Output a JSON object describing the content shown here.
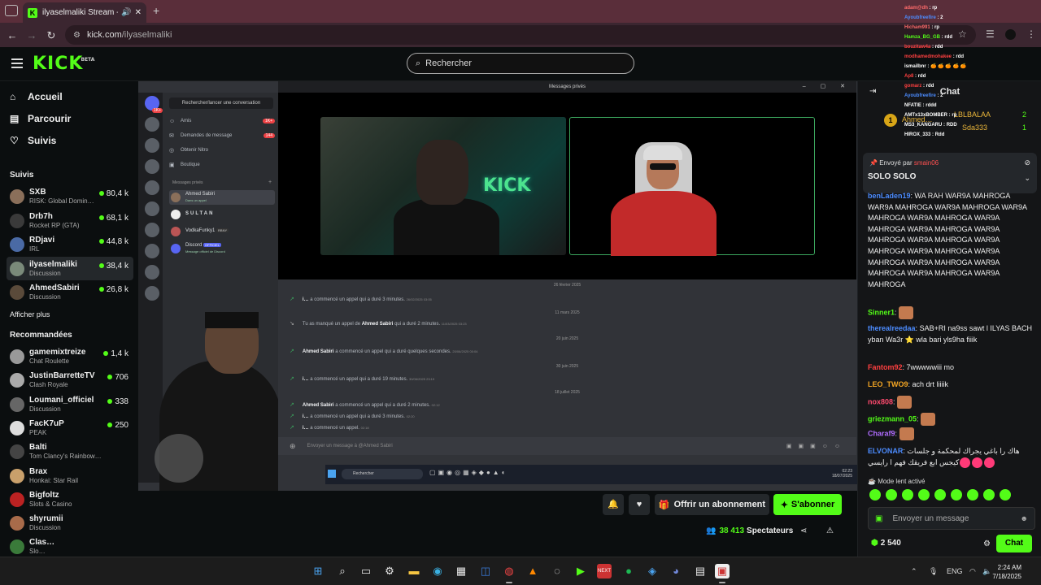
{
  "browser": {
    "tab_title": "ilyaselmaliki Stream - Watc",
    "url_host": "kick.com",
    "url_path": "/ilyaselmaliki"
  },
  "header": {
    "logo": "KICK",
    "logo_badge": "BETA",
    "search_placeholder": "Rechercher"
  },
  "sidebar": {
    "nav": [
      "Accueil",
      "Parcourir",
      "Suivis"
    ],
    "following_title": "Suivis",
    "following": [
      {
        "name": "SXB",
        "category": "RISK: Global Domin…",
        "viewers": "80,4 k"
      },
      {
        "name": "Drb7h",
        "category": "Rocket RP (GTA)",
        "viewers": "68,1 k"
      },
      {
        "name": "RDjavi",
        "category": "IRL",
        "viewers": "44,8 k"
      },
      {
        "name": "ilyaselmaliki",
        "category": "Discussion",
        "viewers": "38,4 k"
      },
      {
        "name": "AhmedSabiri",
        "category": "Discussion",
        "viewers": "26,8 k"
      }
    ],
    "show_more": "Afficher plus",
    "recommended_title": "Recommandées",
    "recommended": [
      {
        "name": "gamemixtreize",
        "category": "Chat Roulette",
        "viewers": "1,4 k"
      },
      {
        "name": "JustinBarretteTV",
        "category": "Clash Royale",
        "viewers": "706"
      },
      {
        "name": "Loumani_officiel",
        "category": "Discussion",
        "viewers": "338"
      },
      {
        "name": "FacK7uP",
        "category": "PEAK",
        "viewers": "250"
      },
      {
        "name": "Balti",
        "category": "Tom Clancy's Rainbow…",
        "viewers": ""
      },
      {
        "name": "Brax",
        "category": "Honkai: Star Rail",
        "viewers": ""
      },
      {
        "name": "Bigfoltz",
        "category": "Slots & Casino",
        "viewers": ""
      },
      {
        "name": "shyrumii",
        "category": "Discussion",
        "viewers": ""
      },
      {
        "name": "Clas…",
        "category": "Slo…",
        "viewers": ""
      }
    ]
  },
  "discord": {
    "window_title": "Messages privés",
    "dm_search": "Rechercher/lancer une conversation",
    "menu": [
      {
        "label": "Amis",
        "badge": "1K+"
      },
      {
        "label": "Demandes de message",
        "badge": "144"
      },
      {
        "label": "Obtenir Nitro",
        "badge": ""
      },
      {
        "label": "Boutique",
        "badge": ""
      }
    ],
    "dm_header": "Messages privés",
    "dms": [
      {
        "name": "Ahmed Sabiri",
        "status": "Dans un appel"
      },
      {
        "name": "SULTAN",
        "status": ""
      },
      {
        "name": "VodkaFunky1",
        "status": "",
        "tag": "RBNY"
      },
      {
        "name": "Discord",
        "status": "Message officiel de Discord",
        "tag": "OFFICIEL"
      }
    ],
    "call_log": [
      {
        "type": "date",
        "text": "26 février 2025"
      },
      {
        "type": "call",
        "user": "i…",
        "text": "a commencé un appel qui a duré 3 minutes.",
        "time": "26/02/2025 03:05"
      },
      {
        "type": "date",
        "text": "11 mars 2025"
      },
      {
        "type": "missed",
        "user": "",
        "text": "Tu as manqué un appel de",
        "who": "Ahmed Sabiri",
        "text2": "qui a duré 2 minutes.",
        "time": "11/03/2025 03:23"
      },
      {
        "type": "date",
        "text": "20 juin 2025"
      },
      {
        "type": "call",
        "user": "Ahmed Sabiri",
        "text": "a commencé un appel qui a duré quelques secondes.",
        "time": "20/06/2025 00:04"
      },
      {
        "type": "date",
        "text": "30 juin 2025"
      },
      {
        "type": "call",
        "user": "i…",
        "text": "a commencé un appel qui a duré 19 minutes.",
        "time": "30/06/2025 23:19"
      },
      {
        "type": "date",
        "text": "18 juillet 2025"
      },
      {
        "type": "call",
        "user": "Ahmed Sabiri",
        "text": "a commencé un appel qui a duré 2 minutes.",
        "time": "02:12"
      },
      {
        "type": "call",
        "user": "i…",
        "text": "a commencé un appel qui a duré 3 minutes.",
        "time": "02:20"
      },
      {
        "type": "call",
        "user": "i…",
        "text": "a commencé un appel.",
        "time": "02:18"
      }
    ],
    "message_placeholder": "Envoyer un message à @Ahmed Sabiri",
    "video_text": "KICK",
    "inner_search": "Rechercher",
    "inner_time": "02:23",
    "inner_date": "18/07/2025"
  },
  "player_actions": {
    "subscribe_gift": "Offrir un abonnement",
    "subscribe": "S'abonner",
    "viewers": "38 413",
    "viewers_label": "Spectateurs"
  },
  "chat": {
    "title": "Chat",
    "leaderboard": [
      {
        "rank": "1",
        "user": "Ahmed…",
        "count": ""
      },
      {
        "user": "LBLBALAA",
        "count": "2"
      },
      {
        "user": "Sda333",
        "count": "1"
      }
    ],
    "pinned_by_label": "Envoyé par",
    "pinned_by": "smain06",
    "pinned_text": "SOLO     SOLO",
    "messages": [
      {
        "user": "benLaden19",
        "color": "#4c8cff",
        "text": "WA RAH WAR9A MAHROGA WAR9A MAHROGA WAR9A MAHROGA WAR9A MAHROGA WAR9A MAHROGA WAR9A MAHROGA WAR9A MAHROGA WAR9A MAHROGA WAR9A MAHROGA WAR9A MAHROGA WAR9A MAHROGA WAR9A MAHROGA WAR9A MAHROGA WAR9A MAHROGA WAR9A MAHROGA WAR9A MAHROGA"
      },
      {
        "user": "Sinner1",
        "color": "#53fc18",
        "text": ""
      },
      {
        "user": "therealreedaa",
        "color": "#4c8cff",
        "text": "SAB+RI na9ss sawt l ILYAS BACH yban Wa3r ⭐ wla bari yls9ha fiiik"
      },
      {
        "user": "Fantom92",
        "color": "#ff4040",
        "text": "7wwwwwiii mo"
      },
      {
        "user": "LEO_TWO9",
        "color": "#f5a623",
        "text": "ach drt liiiik"
      },
      {
        "user": "nox808",
        "color": "#ff4a6e",
        "text": ""
      },
      {
        "user": "griezmann_05",
        "color": "#53fc18",
        "text": ""
      },
      {
        "user": "Charaf9",
        "color": "#b06cff",
        "text": ""
      },
      {
        "user": "ELVONAR",
        "color": "#4c8cff",
        "text": "هاك را باغي يجراك لمحكمة و جلسات كيجس ابع فريقك فهم ا رايسي"
      }
    ],
    "slow_mode": "Mode lent activé",
    "input_placeholder": "Envoyer un message",
    "points": "2 540",
    "send": "Chat"
  },
  "overlay_chat": [
    {
      "user": "adam@dh",
      "text": "rp",
      "color": "#ff6b6b"
    },
    {
      "user": "Ayoubfreefire",
      "text": "2",
      "color": "#4c8cff"
    },
    {
      "user": "Hicham991",
      "text": "rp",
      "color": "#ff6b6b"
    },
    {
      "user": "Hamza_BG_GB",
      "text": "rdd",
      "color": "#53fc18"
    },
    {
      "user": "bouzitaw4a",
      "text": "rdd",
      "color": "#ff4040"
    },
    {
      "user": "modhamedmohakee",
      "text": "rdd",
      "color": "#ff4040"
    },
    {
      "user": "ismailbnr",
      "text": "🍊 🍊 🍊 🍊 🍊",
      "color": "#ffffff"
    },
    {
      "user": "Ap8",
      "text": "rdd",
      "color": "#ff4040"
    },
    {
      "user": "gomarz",
      "text": "rdd",
      "color": "#ff4040"
    },
    {
      "user": "Ayoubfreefire",
      "text": "2",
      "color": "#4c8cff"
    },
    {
      "user": "NFATIE",
      "text": "rddd",
      "color": "#ffffff"
    },
    {
      "user": "AMTx13xBOMBER",
      "text": "rp",
      "color": "#ffffff"
    },
    {
      "user": "MS3_KANGARU",
      "text": "RDD",
      "color": "#ffffff"
    },
    {
      "user": "HIROX_333",
      "text": "Rdd",
      "color": "#ffffff"
    }
  ],
  "taskbar": {
    "lang": "ENG",
    "time": "2:24 AM",
    "date": "7/18/2025"
  }
}
